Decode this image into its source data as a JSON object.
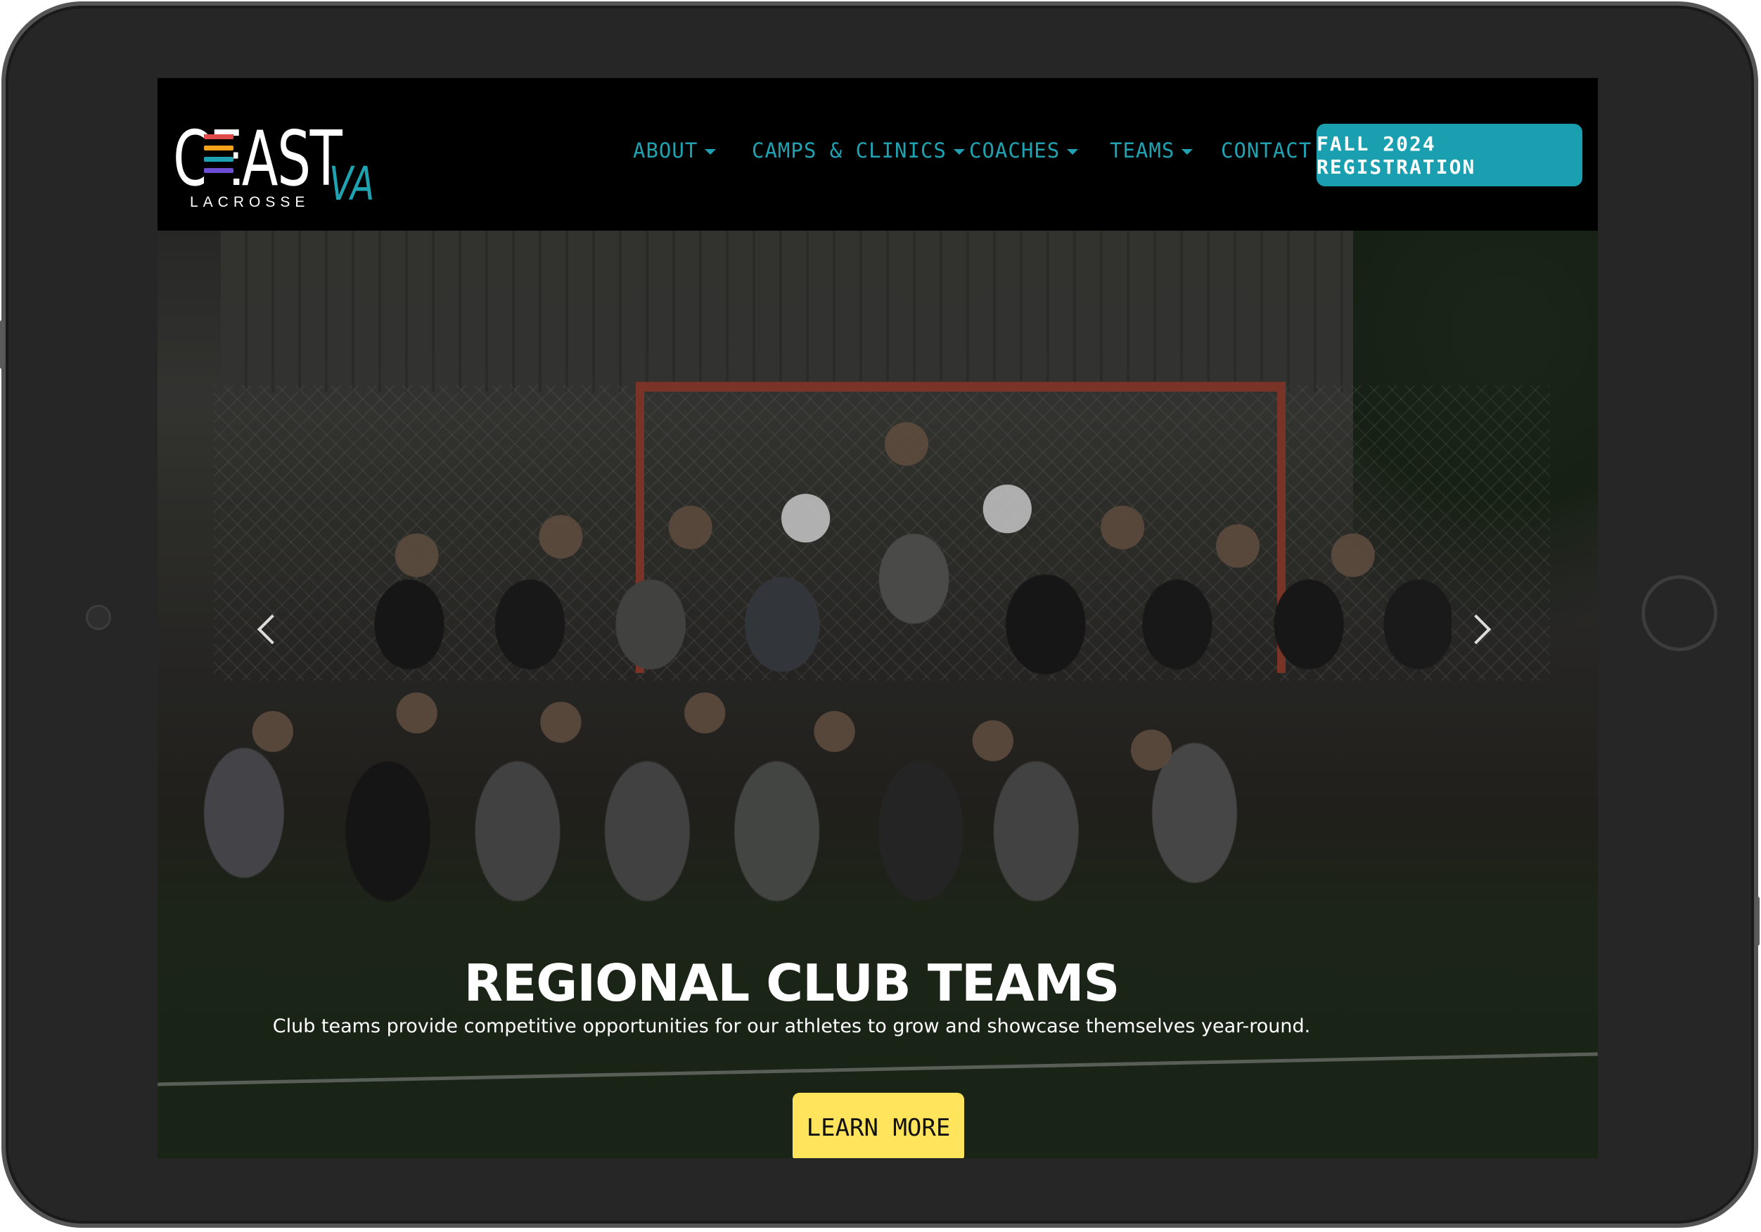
{
  "logo": {
    "wordmark": "CEAST",
    "region": "VA",
    "subtitle": "LACROSSE"
  },
  "nav": {
    "items": [
      {
        "label": "ABOUT",
        "dropdown": true
      },
      {
        "label": "CAMPS & CLINICS",
        "dropdown": true
      },
      {
        "label": "COACHES",
        "dropdown": true
      },
      {
        "label": "TEAMS",
        "dropdown": true
      },
      {
        "label": "CONTACT",
        "dropdown": false
      }
    ],
    "cta_label": "FALL 2024 REGISTRATION"
  },
  "hero": {
    "title": "REGIONAL CLUB TEAMS",
    "subtitle": "Club teams provide competitive opportunities for our athletes to grow and showcase themselves year-round.",
    "button_label": "LEARN MORE",
    "slide_count": 4,
    "active_slide": 2
  },
  "colors": {
    "accent": "#1fa2b1",
    "cta_bg": "#1a9fb0",
    "button_yellow": "#ffe45c",
    "logo_stripes": [
      "#e24b4b",
      "#f4a21c",
      "#1fa2b1",
      "#6c4fd6"
    ]
  },
  "icons": {
    "prev": "chevron-left-icon",
    "next": "chevron-right-icon",
    "dropdown": "caret-down-icon"
  }
}
